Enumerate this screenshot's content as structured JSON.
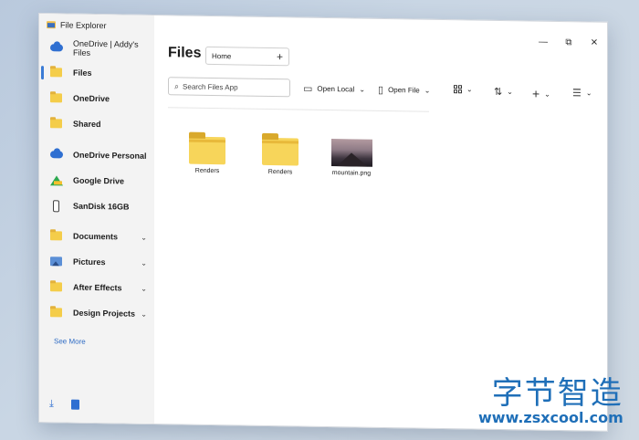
{
  "window": {
    "title": "File Explorer"
  },
  "window_controls": {
    "minimize": "—",
    "maximize": "⧉",
    "close": "✕"
  },
  "sidebar": {
    "account": "OneDrive | Addy's Files",
    "items": [
      {
        "label": "Files",
        "icon": "folder-icon"
      },
      {
        "label": "OneDrive",
        "icon": "folder-icon"
      },
      {
        "label": "Shared",
        "icon": "folder-icon"
      },
      {
        "label": "OneDrive Personal",
        "icon": "cloud-icon"
      },
      {
        "label": "Google Drive",
        "icon": "google-drive-icon"
      },
      {
        "label": "SanDisk 16GB",
        "icon": "usb-drive-icon"
      },
      {
        "label": "Documents",
        "icon": "folder-icon"
      },
      {
        "label": "Pictures",
        "icon": "pictures-icon"
      },
      {
        "label": "After Effects",
        "icon": "folder-icon"
      },
      {
        "label": "Design Projects",
        "icon": "folder-icon"
      }
    ],
    "see_more": "See More"
  },
  "main": {
    "title": "Files",
    "tab_label": "Home",
    "search_placeholder": "Search Files App",
    "toolbar": {
      "open_local": "Open Local",
      "open_file": "Open File"
    },
    "files": [
      {
        "name": "Renders",
        "type": "folder"
      },
      {
        "name": "Renders",
        "type": "folder"
      },
      {
        "name": "mountain.png",
        "type": "image"
      }
    ]
  },
  "watermark": {
    "text_cn": "字节智造",
    "url": "www.zsxcool.com"
  },
  "colors": {
    "accent": "#3a7bd5",
    "folder": "#f4cd4a",
    "watermark": "#1f6fb8"
  }
}
